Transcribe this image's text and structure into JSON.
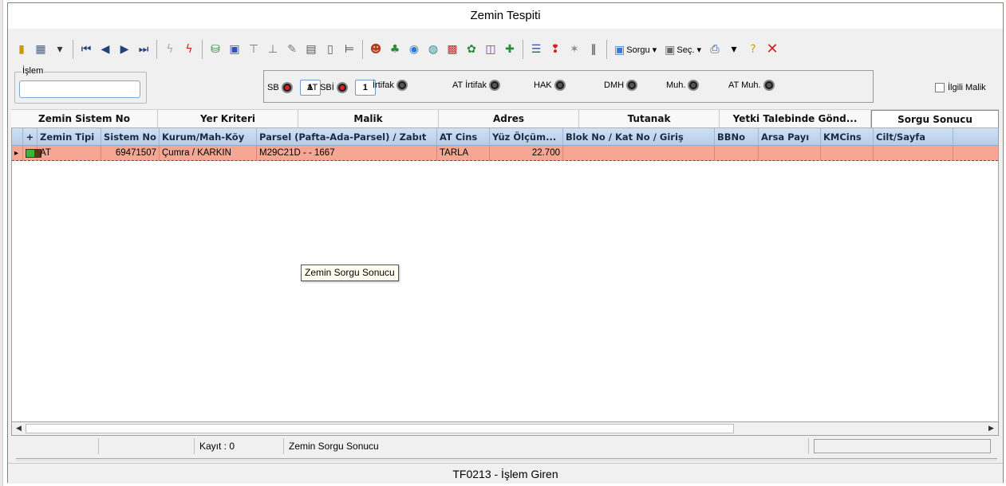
{
  "window": {
    "title": "Zemin Tespiti",
    "footer": "TF0213 - İşlem Giren"
  },
  "toolbar": {
    "buttons": [
      {
        "name": "record-icon",
        "glyph": "▮",
        "color": "#c79a00"
      },
      {
        "name": "grid-view-icon",
        "glyph": "▦",
        "color": "#3a5fa0"
      },
      {
        "name": "dropdown-icon",
        "glyph": "▾",
        "color": "#333"
      },
      {
        "name": "first-record-icon",
        "glyph": "⏮",
        "color": "#243f7a"
      },
      {
        "name": "prev-record-icon",
        "glyph": "◀",
        "color": "#243f7a"
      },
      {
        "name": "next-record-icon",
        "glyph": "▶",
        "color": "#243f7a"
      },
      {
        "name": "last-record-icon",
        "glyph": "⏭",
        "color": "#243f7a"
      },
      {
        "name": "lightning-disabled-icon",
        "glyph": "ϟ",
        "color": "#aaaaaa"
      },
      {
        "name": "lightning-icon",
        "glyph": "ϟ",
        "color": "#d02020"
      },
      {
        "name": "database-check-icon",
        "glyph": "⛁",
        "color": "#2a8a3a"
      },
      {
        "name": "blocked-icon",
        "glyph": "▣",
        "color": "#3050c8"
      },
      {
        "name": "filter-icon",
        "glyph": "⊤",
        "color": "#777"
      },
      {
        "name": "anchor-icon",
        "glyph": "⊥",
        "color": "#777"
      },
      {
        "name": "document-edit-icon",
        "glyph": "✎",
        "color": "#777"
      },
      {
        "name": "report-icon",
        "glyph": "▤",
        "color": "#555"
      },
      {
        "name": "blank-page-icon",
        "glyph": "▯",
        "color": "#555"
      },
      {
        "name": "tree-icon",
        "glyph": "⊨",
        "color": "#444"
      },
      {
        "name": "people-icon",
        "glyph": "☻",
        "color": "#b04020"
      },
      {
        "name": "pin-icon",
        "glyph": "♣",
        "color": "#2a8a3a"
      },
      {
        "name": "globe-icon",
        "glyph": "◉",
        "color": "#2a7ad0"
      },
      {
        "name": "search-map-icon",
        "glyph": "◍",
        "color": "#2a8a8a"
      },
      {
        "name": "colored-grid-icon",
        "glyph": "▩",
        "color": "#c03030"
      },
      {
        "name": "map-icon",
        "glyph": "✿",
        "color": "#2a8a3a"
      },
      {
        "name": "frame-icon",
        "glyph": "◫",
        "color": "#7a3aa0"
      },
      {
        "name": "chart-icon",
        "glyph": "✚",
        "color": "#2a8a3a"
      },
      {
        "name": "list-icon",
        "glyph": "☰",
        "color": "#3050a0"
      },
      {
        "name": "alert-icon",
        "glyph": "❢",
        "color": "#d02020"
      },
      {
        "name": "tools-icon",
        "glyph": "✶",
        "color": "#888"
      },
      {
        "name": "paperclip-icon",
        "glyph": "∥",
        "color": "#333"
      }
    ],
    "sorgu_label": "Sorgu",
    "sec_label": "Seç.",
    "print_icon": "printer-icon",
    "help_icon": "help-icon",
    "close_icon": "close-icon"
  },
  "islem": {
    "label": "İşlem",
    "value": ""
  },
  "options": [
    {
      "label": "SB",
      "state": "red",
      "spin": "1"
    },
    {
      "label": "AT SBİ",
      "state": "red",
      "spin": "1"
    },
    {
      "label": "İrtifak",
      "state": "dark"
    },
    {
      "label": "AT İrtifak",
      "state": "dark"
    },
    {
      "label": "HAK",
      "state": "dark"
    },
    {
      "label": "DMH",
      "state": "dark"
    },
    {
      "label": "Muh.",
      "state": "dark"
    },
    {
      "label": "AT Muh.",
      "state": "dark"
    }
  ],
  "ilgili_malik": {
    "label": "İlgili Malik",
    "checked": false
  },
  "tabs": [
    {
      "label": "Zemin Sistem No",
      "active": false
    },
    {
      "label": "Yer Kriteri",
      "active": false
    },
    {
      "label": "Malik",
      "active": false
    },
    {
      "label": "Adres",
      "active": false
    },
    {
      "label": "Tutanak",
      "active": false
    },
    {
      "label": "Yetki Talebinde Gönd...",
      "active": false
    },
    {
      "label": "Sorgu Sonucu",
      "active": true
    }
  ],
  "grid": {
    "columns": [
      "",
      "+",
      "Zemin Tipi",
      "Sistem No",
      "Kurum/Mah-Köy",
      "Parsel (Pafta-Ada-Parsel) / Zabıt",
      "AT Cins",
      "Yüz Ölçüm...",
      "Blok No / Kat No / Giriş",
      "BBNo",
      "Arsa Payı",
      "KMCins",
      "Cilt/Sayfa"
    ],
    "rows": [
      [
        "",
        "",
        "AT",
        "69471507",
        "Çumra / KARKIN",
        "M29C21D - - 1667",
        "TARLA",
        "22.700",
        "",
        "",
        "",
        "",
        ""
      ]
    ]
  },
  "tooltip": "Zemin Sorgu Sonucu",
  "status": {
    "kayit": "Kayıt : 0",
    "message": "Zemin Sorgu Sonucu"
  },
  "colors": {
    "row_highlight": "#f5a794",
    "header_bg": "#c4d8ef",
    "accent": "#4b8fd6"
  }
}
